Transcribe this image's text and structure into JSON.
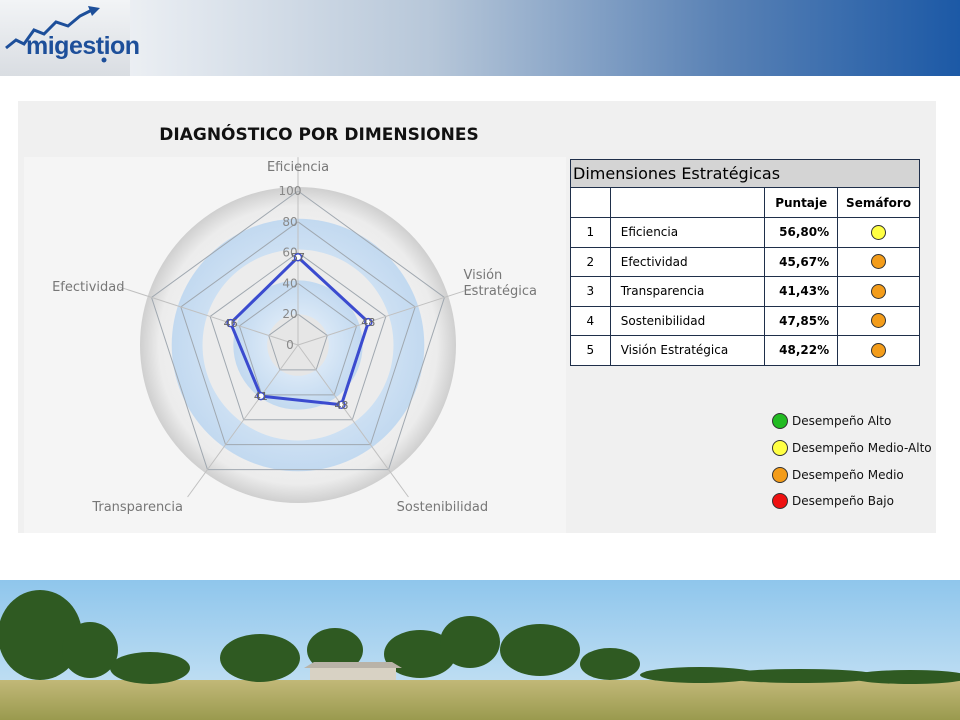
{
  "brand": {
    "name": "migestion"
  },
  "colors": {
    "alto": "#22bb22",
    "medio_alto": "#ffff44",
    "medio": "#f39c1a",
    "bajo": "#ee1111",
    "series": "#3b4bcf"
  },
  "chart_data": {
    "type": "radar",
    "title": "DIAGNÓSTICO POR DIMENSIONES",
    "axes": [
      "Eficiencia",
      "Visión Estratégica",
      "Sostenibilidad",
      "Transparencia",
      "Efectividad"
    ],
    "axis_label_lines": [
      [
        "Eficiencia"
      ],
      [
        "Visión",
        "Estratégica"
      ],
      [
        "Sostenibilidad"
      ],
      [
        "Transparencia"
      ],
      [
        "Efectividad"
      ]
    ],
    "values": [
      57,
      48,
      48,
      41,
      46
    ],
    "value_labels": [
      "57",
      "48",
      "48",
      "41",
      "46"
    ],
    "rmin": 0,
    "rmax": 100,
    "ticks": [
      0,
      20,
      40,
      60,
      80,
      100
    ]
  },
  "table": {
    "title": "Dimensiones Estratégicas",
    "headers": {
      "num": "",
      "name": "",
      "score": "Puntaje",
      "light": "Semáforo"
    },
    "rows": [
      {
        "num": "1",
        "name": "Eficiencia",
        "score": "56,80%",
        "light": "medio_alto"
      },
      {
        "num": "2",
        "name": "Efectividad",
        "score": "45,67%",
        "light": "medio"
      },
      {
        "num": "3",
        "name": "Transparencia",
        "score": "41,43%",
        "light": "medio"
      },
      {
        "num": "4",
        "name": "Sostenibilidad",
        "score": "47,85%",
        "light": "medio"
      },
      {
        "num": "5",
        "name": "Visión Estratégica",
        "score": "48,22%",
        "light": "medio"
      }
    ]
  },
  "legend": [
    {
      "key": "alto",
      "label": "Desempeño Alto"
    },
    {
      "key": "medio_alto",
      "label": "Desempeño Medio-Alto"
    },
    {
      "key": "medio",
      "label": "Desempeño Medio"
    },
    {
      "key": "bajo",
      "label": "Desempeño Bajo"
    }
  ]
}
